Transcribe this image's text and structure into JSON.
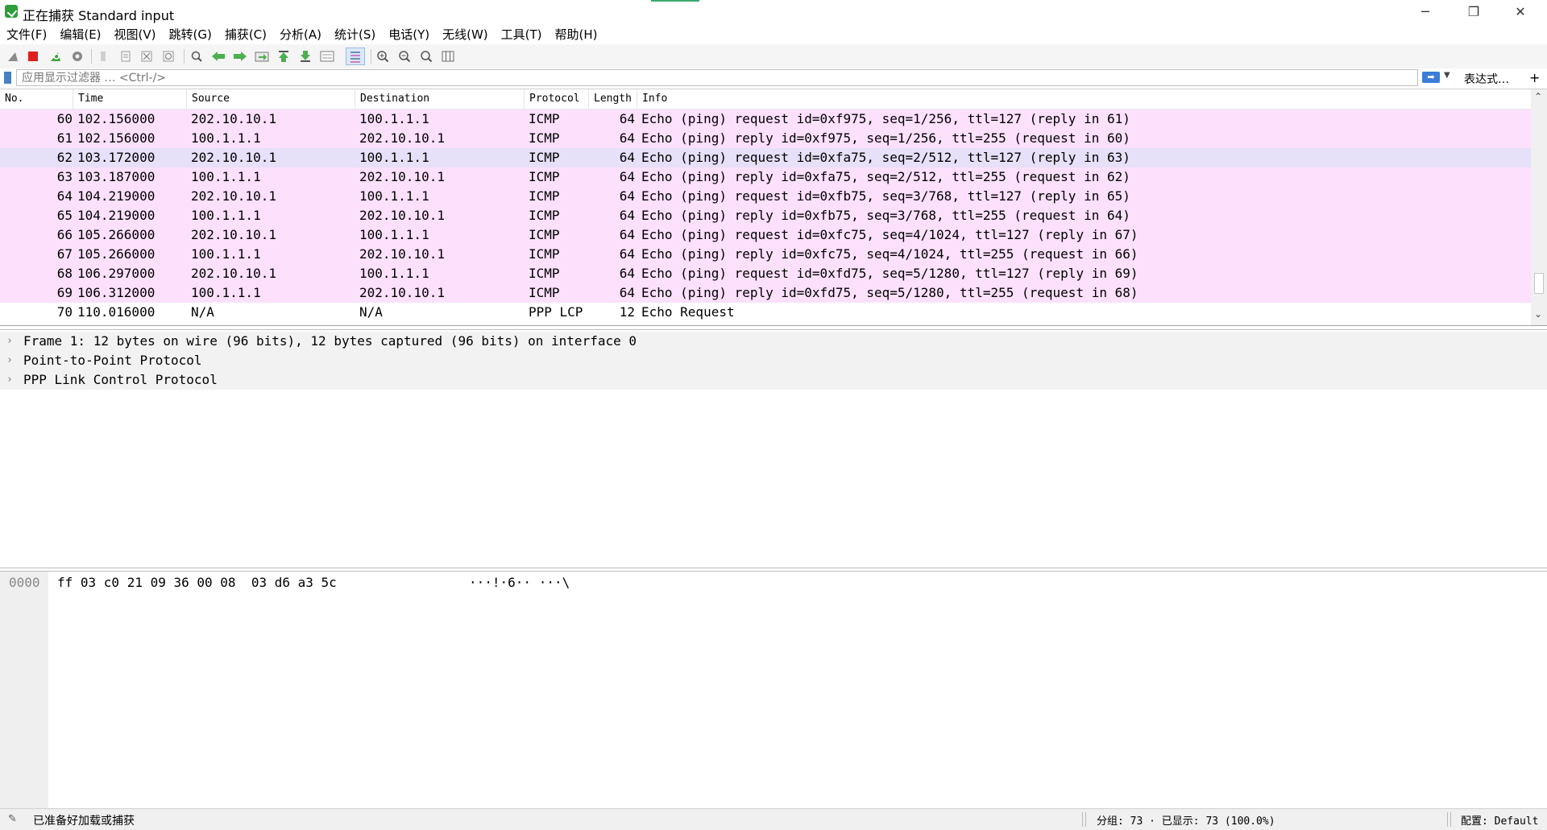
{
  "window": {
    "title": "正在捕获 Standard input",
    "minimize": "─",
    "restore": "❐",
    "close": "✕"
  },
  "menu": [
    "文件(F)",
    "编辑(E)",
    "视图(V)",
    "跳转(G)",
    "捕获(C)",
    "分析(A)",
    "统计(S)",
    "电话(Y)",
    "无线(W)",
    "工具(T)",
    "帮助(H)"
  ],
  "toolbar": {
    "icons": [
      "shark-fin-icon",
      "stop-capture-icon",
      "restart-capture-icon",
      "capture-options-icon",
      "open-file-icon",
      "save-file-icon",
      "close-file-icon",
      "reload-icon",
      "find-packet-icon",
      "go-back-icon",
      "go-forward-icon",
      "go-to-packet-icon",
      "go-first-icon",
      "go-last-icon",
      "autoscroll-icon",
      "colorize-icon",
      "zoom-in-icon",
      "zoom-out-icon",
      "zoom-normal-icon",
      "resize-columns-icon"
    ]
  },
  "filter": {
    "placeholder": "应用显示过滤器 … <Ctrl-/>",
    "apply_label": "➡",
    "expression_label": "表达式…",
    "add_label": "+"
  },
  "packet_list": {
    "columns": [
      "No.",
      "Time",
      "Source",
      "Destination",
      "Protocol",
      "Length",
      "Info"
    ],
    "rows": [
      {
        "no": "60",
        "time": "102.156000",
        "src": "202.10.10.1",
        "dst": "100.1.1.1",
        "proto": "ICMP",
        "len": "64",
        "info": "Echo (ping) request  id=0xf975, seq=1/256, ttl=127 (reply in 61)",
        "bg": "#fce0fc"
      },
      {
        "no": "61",
        "time": "102.156000",
        "src": "100.1.1.1",
        "dst": "202.10.10.1",
        "proto": "ICMP",
        "len": "64",
        "info": "Echo (ping) reply    id=0xf975, seq=1/256, ttl=255 (request in 60)",
        "bg": "#fce0fc"
      },
      {
        "no": "62",
        "time": "103.172000",
        "src": "202.10.10.1",
        "dst": "100.1.1.1",
        "proto": "ICMP",
        "len": "64",
        "info": "Echo (ping) request  id=0xfa75, seq=2/512, ttl=127 (reply in 63)",
        "bg": "#e6e0f8"
      },
      {
        "no": "63",
        "time": "103.187000",
        "src": "100.1.1.1",
        "dst": "202.10.10.1",
        "proto": "ICMP",
        "len": "64",
        "info": "Echo (ping) reply    id=0xfa75, seq=2/512, ttl=255 (request in 62)",
        "bg": "#fce0fc"
      },
      {
        "no": "64",
        "time": "104.219000",
        "src": "202.10.10.1",
        "dst": "100.1.1.1",
        "proto": "ICMP",
        "len": "64",
        "info": "Echo (ping) request  id=0xfb75, seq=3/768, ttl=127 (reply in 65)",
        "bg": "#fce0fc"
      },
      {
        "no": "65",
        "time": "104.219000",
        "src": "100.1.1.1",
        "dst": "202.10.10.1",
        "proto": "ICMP",
        "len": "64",
        "info": "Echo (ping) reply    id=0xfb75, seq=3/768, ttl=255 (request in 64)",
        "bg": "#fce0fc"
      },
      {
        "no": "66",
        "time": "105.266000",
        "src": "202.10.10.1",
        "dst": "100.1.1.1",
        "proto": "ICMP",
        "len": "64",
        "info": "Echo (ping) request  id=0xfc75, seq=4/1024, ttl=127 (reply in 67)",
        "bg": "#fce0fc"
      },
      {
        "no": "67",
        "time": "105.266000",
        "src": "100.1.1.1",
        "dst": "202.10.10.1",
        "proto": "ICMP",
        "len": "64",
        "info": "Echo (ping) reply    id=0xfc75, seq=4/1024, ttl=255 (request in 66)",
        "bg": "#fce0fc"
      },
      {
        "no": "68",
        "time": "106.297000",
        "src": "202.10.10.1",
        "dst": "100.1.1.1",
        "proto": "ICMP",
        "len": "64",
        "info": "Echo (ping) request  id=0xfd75, seq=5/1280, ttl=127 (reply in 69)",
        "bg": "#fce0fc"
      },
      {
        "no": "69",
        "time": "106.312000",
        "src": "100.1.1.1",
        "dst": "202.10.10.1",
        "proto": "ICMP",
        "len": "64",
        "info": "Echo (ping) reply    id=0xfd75, seq=5/1280, ttl=255 (request in 68)",
        "bg": "#fce0fc"
      },
      {
        "no": "70",
        "time": "110.016000",
        "src": "N/A",
        "dst": "N/A",
        "proto": "PPP LCP",
        "len": "12",
        "info": "Echo Request",
        "bg": "#ffffff"
      }
    ]
  },
  "details": {
    "arrow": "›",
    "items": [
      "Frame 1: 12 bytes on wire (96 bits), 12 bytes captured (96 bits) on interface 0",
      "Point-to-Point Protocol",
      "PPP Link Control Protocol"
    ]
  },
  "bytes": {
    "offset": "0000",
    "hex": "ff 03 c0 21 09 36 00 08  03 d6 a3 5c",
    "ascii": "···!·6·· ···\\"
  },
  "status": {
    "icon": "edit-icon",
    "ready": "已准备好加载或捕获",
    "packets": "分组: 73 · 已显示: 73 (100.0%)",
    "profile": "配置: Default"
  },
  "colors": {
    "icmp_row": "#fce0fc",
    "selected_row": "#e6e0f8",
    "accent": "#3b7dd8"
  }
}
